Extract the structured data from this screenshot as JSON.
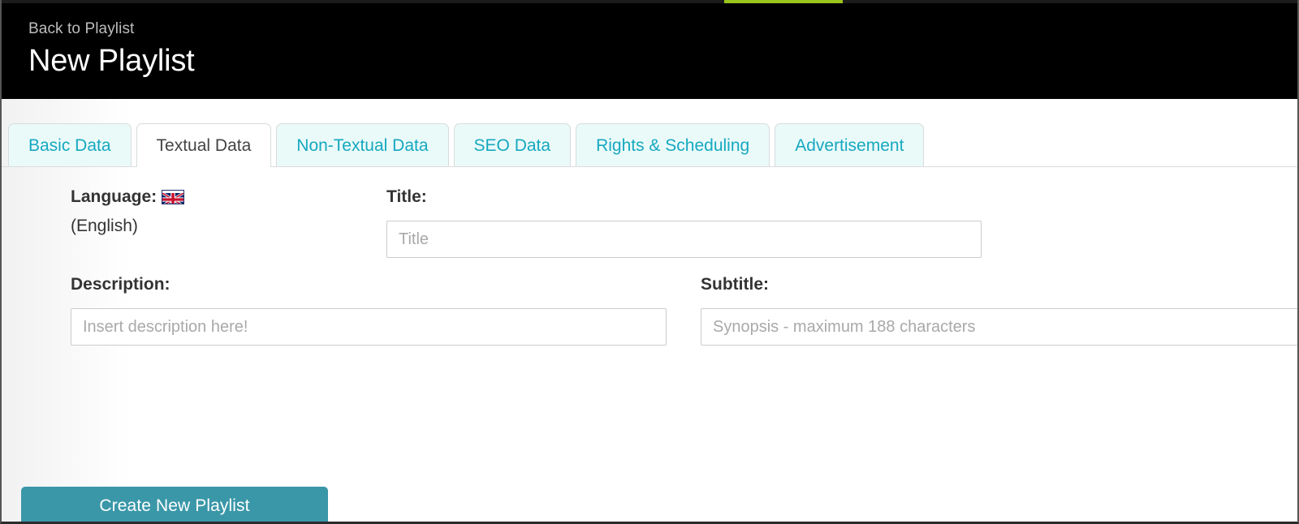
{
  "theme": {
    "header_bg": "#000000",
    "accent_cyan": "#16a8c0",
    "tab_inactive_bg": "#eafaf9",
    "button_teal": "#3a97a8",
    "progress_green": "#9ac51c",
    "border_gray": "#cccccc",
    "placeholder_gray": "#a9a9a9"
  },
  "header": {
    "back_link": "Back to Playlist",
    "title": "New Playlist"
  },
  "tabs": [
    {
      "label": "Basic Data",
      "active": false
    },
    {
      "label": "Textual Data",
      "active": true
    },
    {
      "label": "Non-Textual Data",
      "active": false
    },
    {
      "label": "SEO Data",
      "active": false
    },
    {
      "label": "Rights & Scheduling",
      "active": false
    },
    {
      "label": "Advertisement",
      "active": false
    }
  ],
  "form": {
    "language": {
      "label": "Language:",
      "flag_icon": "uk-flag-icon",
      "value": "(English)"
    },
    "title": {
      "label": "Title:",
      "placeholder": "Title",
      "value": ""
    },
    "description": {
      "label": "Description:",
      "placeholder": "Insert description here!",
      "value": ""
    },
    "subtitle": {
      "label": "Subtitle:",
      "placeholder": "Synopsis - maximum 188 characters",
      "value": ""
    },
    "submit_label": "Create New Playlist"
  }
}
